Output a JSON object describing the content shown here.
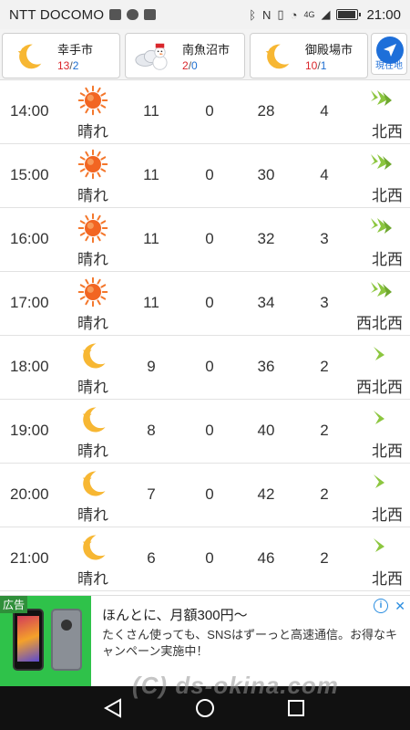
{
  "status_bar": {
    "carrier": "NTT DOCOMO",
    "network": "4G",
    "time": "21:00"
  },
  "cities": [
    {
      "name": "幸手市",
      "high": "13",
      "low": "2",
      "icon": "night-moon-icon"
    },
    {
      "name": "南魚沼市",
      "high": "2",
      "low": "0",
      "icon": "snowman-cloud-icon"
    },
    {
      "name": "御殿場市",
      "high": "10",
      "low": "1",
      "icon": "night-moon-icon"
    }
  ],
  "temp_separator": "/",
  "gps_label": "現在地",
  "rows": [
    {
      "time": "14:00",
      "weather": "晴れ",
      "icon": "sun-icon",
      "temp": "11",
      "precip": "0",
      "humidity": "28",
      "wind": "4",
      "direction": "北西"
    },
    {
      "time": "15:00",
      "weather": "晴れ",
      "icon": "sun-icon",
      "temp": "11",
      "precip": "0",
      "humidity": "30",
      "wind": "4",
      "direction": "北西"
    },
    {
      "time": "16:00",
      "weather": "晴れ",
      "icon": "sun-icon",
      "temp": "11",
      "precip": "0",
      "humidity": "32",
      "wind": "3",
      "direction": "北西"
    },
    {
      "time": "17:00",
      "weather": "晴れ",
      "icon": "sun-icon",
      "temp": "11",
      "precip": "0",
      "humidity": "34",
      "wind": "3",
      "direction": "西北西"
    },
    {
      "time": "18:00",
      "weather": "晴れ",
      "icon": "moon-icon",
      "temp": "9",
      "precip": "0",
      "humidity": "36",
      "wind": "2",
      "direction": "西北西"
    },
    {
      "time": "19:00",
      "weather": "晴れ",
      "icon": "moon-icon",
      "temp": "8",
      "precip": "0",
      "humidity": "40",
      "wind": "2",
      "direction": "北西"
    },
    {
      "time": "20:00",
      "weather": "晴れ",
      "icon": "moon-icon",
      "temp": "7",
      "precip": "0",
      "humidity": "42",
      "wind": "2",
      "direction": "北西"
    },
    {
      "time": "21:00",
      "weather": "晴れ",
      "icon": "moon-icon",
      "temp": "6",
      "precip": "0",
      "humidity": "46",
      "wind": "2",
      "direction": "北西"
    }
  ],
  "ad": {
    "tag": "広告",
    "headline": "ほんとに、月額300円〜",
    "body": "たくさん使っても、SNSはずーっと高速通信。お得なキャンペーン実施中！",
    "info_glyph": "i",
    "close_glyph": "✕"
  },
  "watermark": "(C) ds-okina.com",
  "colors": {
    "high_temp": "#d9262b",
    "low_temp": "#1f6fd0",
    "accent": "#1e6fd9",
    "wind_arrow": "#8cc63f",
    "sun": "#f4762a",
    "moon": "#f7b733"
  }
}
